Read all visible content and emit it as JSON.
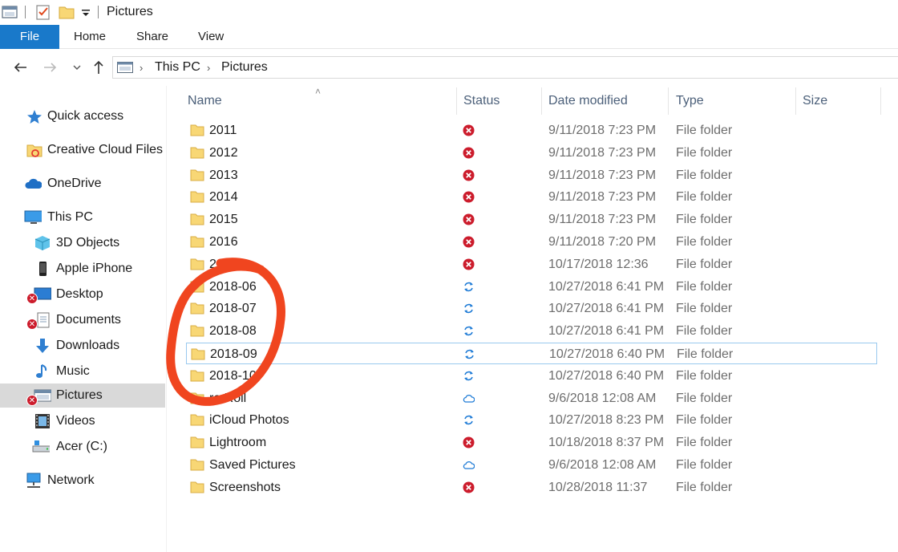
{
  "window": {
    "title": "Pictures"
  },
  "ribbon": {
    "tabs": [
      "File",
      "Home",
      "Share",
      "View"
    ]
  },
  "address": {
    "crumbs": [
      "This PC",
      "Pictures"
    ]
  },
  "sidebar": {
    "items": [
      {
        "label": "Quick access",
        "icon": "star-icon"
      },
      {
        "label": "Creative Cloud Files",
        "icon": "creative-cloud-folder-icon"
      },
      {
        "label": "OneDrive",
        "icon": "onedrive-cloud-icon"
      },
      {
        "label": "This PC",
        "icon": "computer-icon"
      },
      {
        "label": "3D Objects",
        "icon": "cube-icon"
      },
      {
        "label": "Apple iPhone",
        "icon": "phone-icon"
      },
      {
        "label": "Desktop",
        "icon": "desktop-icon"
      },
      {
        "label": "Documents",
        "icon": "documents-icon"
      },
      {
        "label": "Downloads",
        "icon": "download-arrow-icon"
      },
      {
        "label": "Music",
        "icon": "music-note-icon"
      },
      {
        "label": "Pictures",
        "icon": "pictures-icon"
      },
      {
        "label": "Videos",
        "icon": "film-icon"
      },
      {
        "label": "Acer (C:)",
        "icon": "drive-icon"
      },
      {
        "label": "Network",
        "icon": "network-icon"
      }
    ]
  },
  "columns": {
    "name": "Name",
    "status": "Status",
    "date": "Date modified",
    "type": "Type",
    "size": "Size"
  },
  "files": [
    {
      "name": "2011",
      "status": "error",
      "date": "9/11/2018 7:23 PM",
      "type": "File folder"
    },
    {
      "name": "2012",
      "status": "error",
      "date": "9/11/2018 7:23 PM",
      "type": "File folder"
    },
    {
      "name": "2013",
      "status": "error",
      "date": "9/11/2018 7:23 PM",
      "type": "File folder"
    },
    {
      "name": "2014",
      "status": "error",
      "date": "9/11/2018 7:23 PM",
      "type": "File folder"
    },
    {
      "name": "2015",
      "status": "error",
      "date": "9/11/2018 7:23 PM",
      "type": "File folder"
    },
    {
      "name": "2016",
      "status": "error",
      "date": "9/11/2018 7:20 PM",
      "type": "File folder"
    },
    {
      "name": "20",
      "status": "error",
      "date": "10/17/2018 12:36",
      "type": "File folder"
    },
    {
      "name": "2018-06",
      "status": "sync",
      "date": "10/27/2018 6:41 PM",
      "type": "File folder"
    },
    {
      "name": "2018-07",
      "status": "sync",
      "date": "10/27/2018 6:41 PM",
      "type": "File folder"
    },
    {
      "name": "2018-08",
      "status": "sync",
      "date": "10/27/2018 6:41 PM",
      "type": "File folder"
    },
    {
      "name": "2018-09",
      "status": "sync",
      "date": "10/27/2018 6:40 PM",
      "type": "File folder"
    },
    {
      "name": "2018-10",
      "status": "sync",
      "date": "10/27/2018 6:40 PM",
      "type": "File folder"
    },
    {
      "name": "ra Roll",
      "status": "cloud",
      "date": "9/6/2018 12:08 AM",
      "type": "File folder"
    },
    {
      "name": "iCloud Photos",
      "status": "sync",
      "date": "10/27/2018 8:23 PM",
      "type": "File folder"
    },
    {
      "name": "Lightroom",
      "status": "error",
      "date": "10/18/2018 8:37 PM",
      "type": "File folder"
    },
    {
      "name": "Saved Pictures",
      "status": "cloud",
      "date": "9/6/2018 12:08 AM",
      "type": "File folder"
    },
    {
      "name": "Screenshots",
      "status": "error",
      "date": "10/28/2018 11:37",
      "type": "File folder"
    }
  ],
  "colors": {
    "accent": "#1979ca",
    "error": "#cc1c2c",
    "sync": "#1e7bd6",
    "folder": "#f8d775",
    "annotation": "#f0451f"
  }
}
